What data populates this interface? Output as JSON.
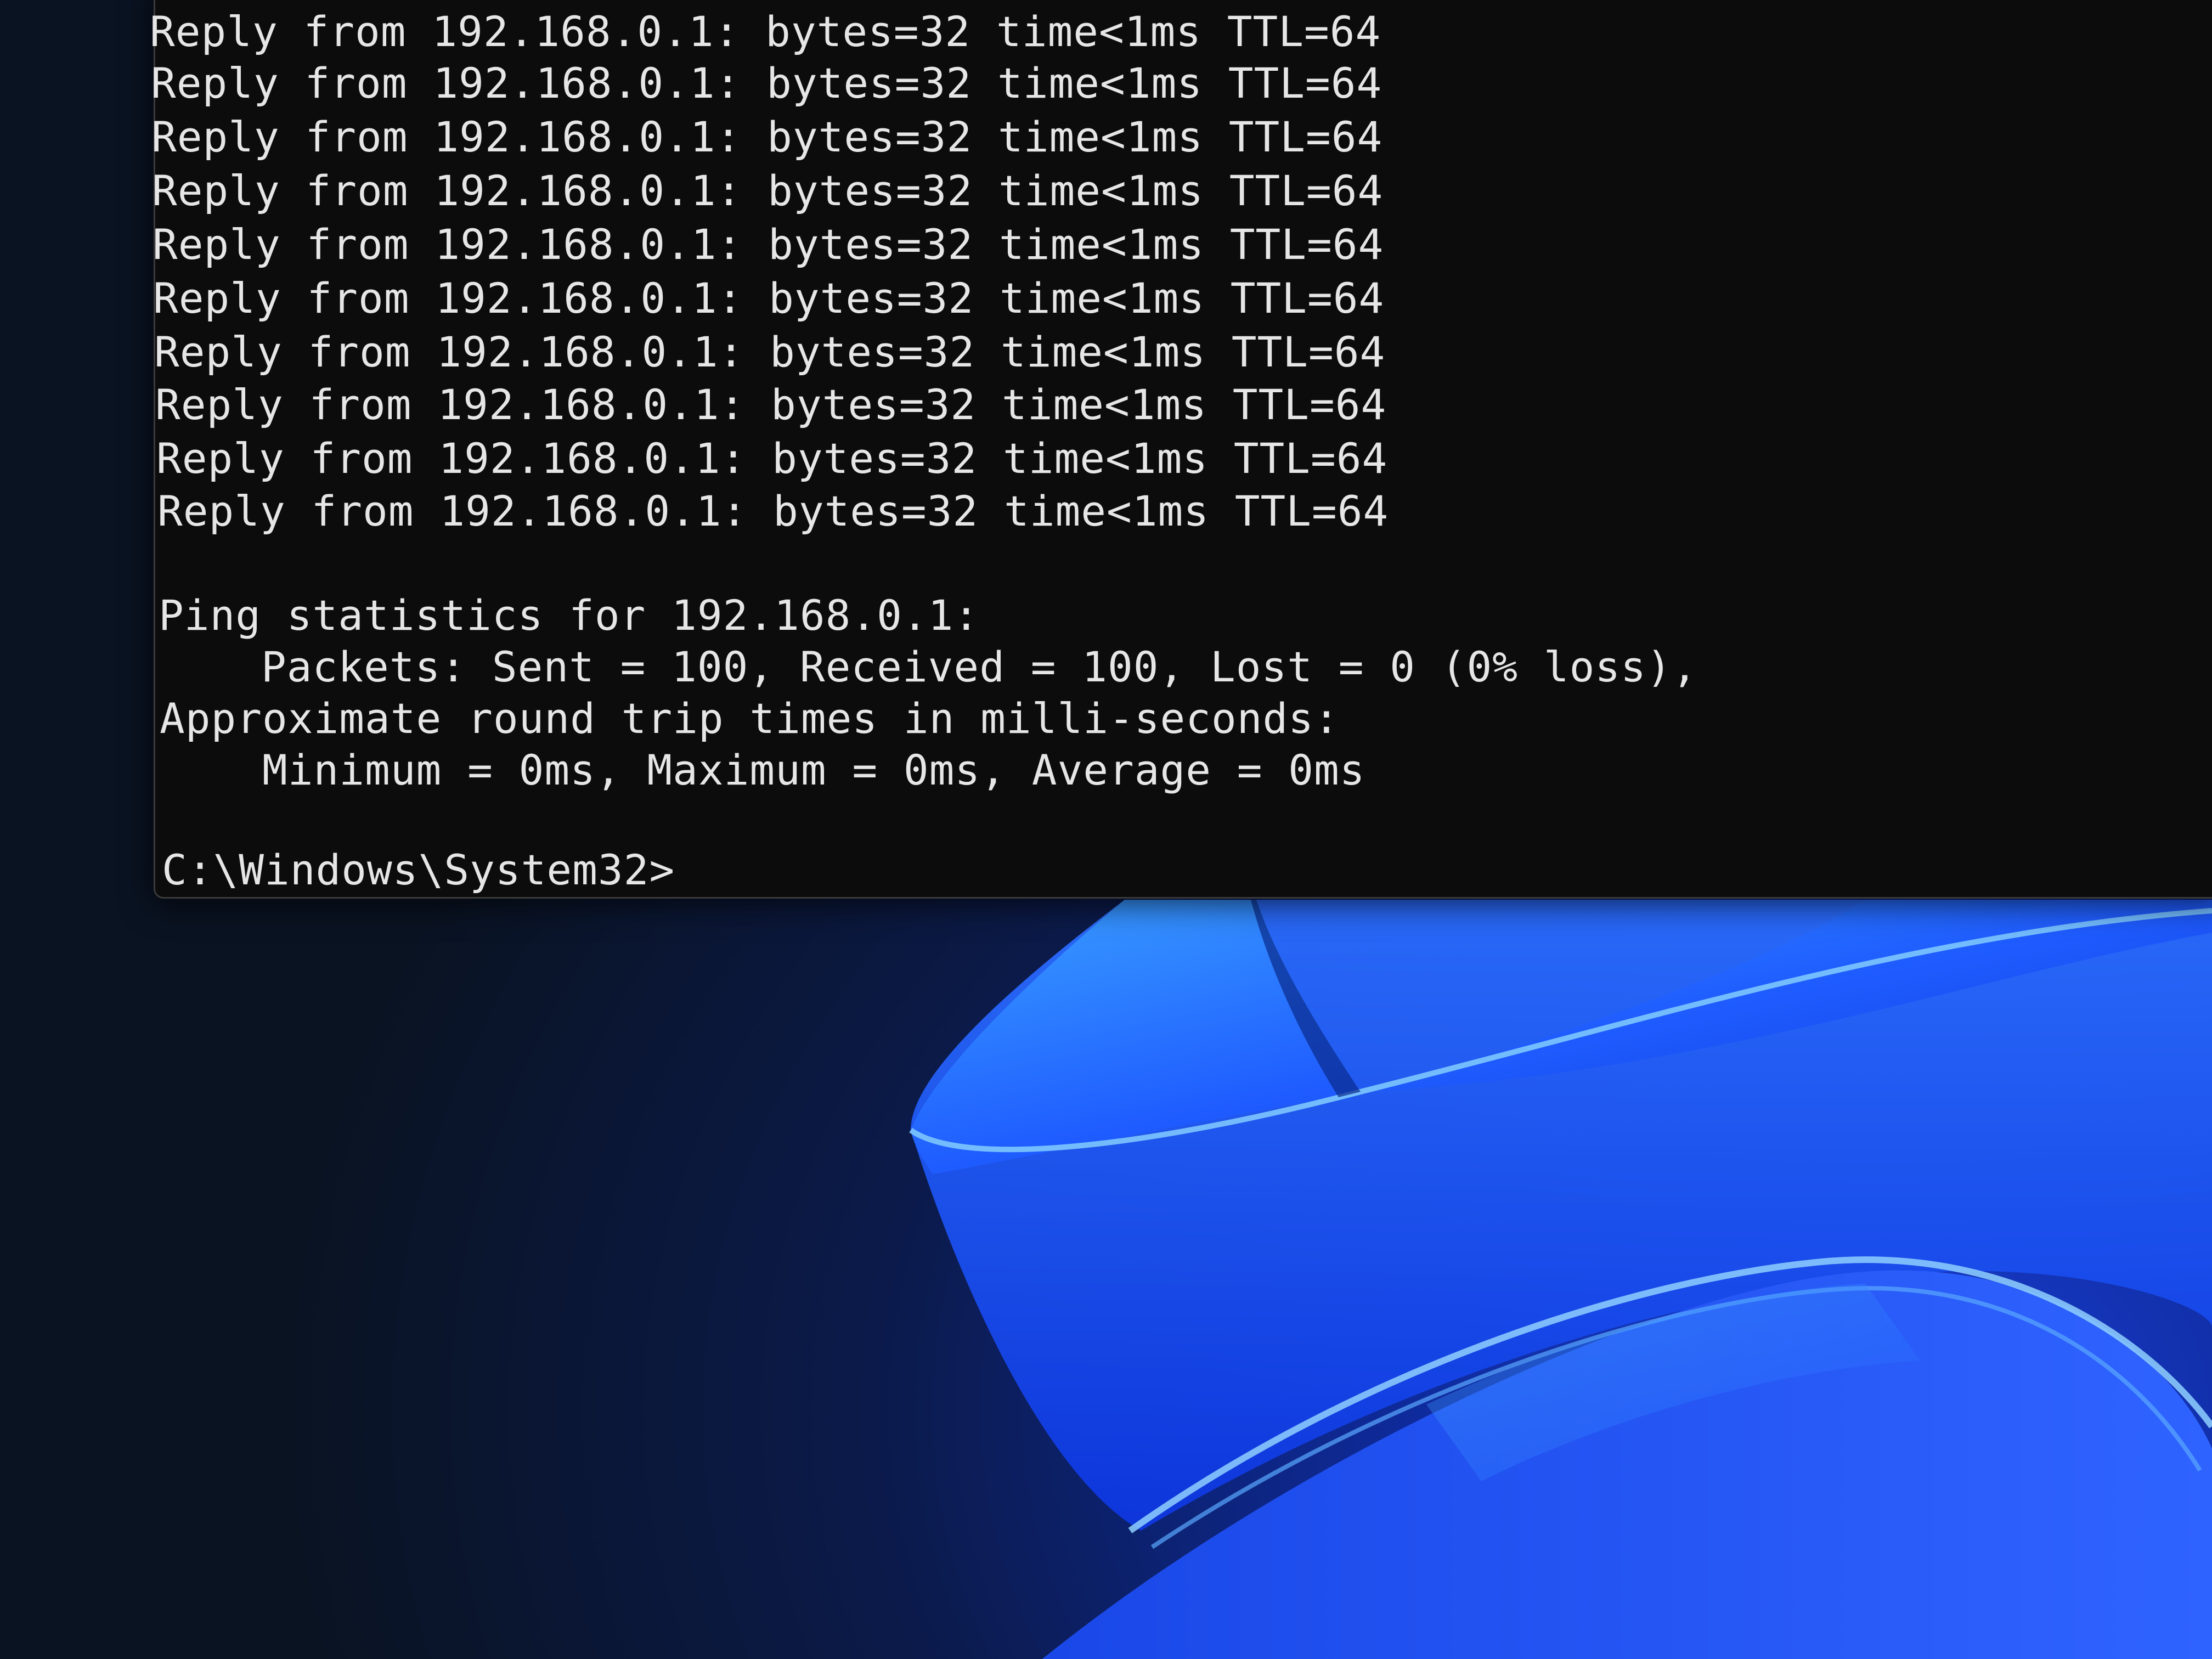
{
  "terminal": {
    "reply_lines": [
      "Reply from 192.168.0.1: bytes=32 time<1ms TTL=64",
      "Reply from 192.168.0.1: bytes=32 time<1ms TTL=64",
      "Reply from 192.168.0.1: bytes=32 time<1ms TTL=64",
      "Reply from 192.168.0.1: bytes=32 time<1ms TTL=64",
      "Reply from 192.168.0.1: bytes=32 time<1ms TTL=64",
      "Reply from 192.168.0.1: bytes=32 time<1ms TTL=64",
      "Reply from 192.168.0.1: bytes=32 time<1ms TTL=64",
      "Reply from 192.168.0.1: bytes=32 time<1ms TTL=64",
      "Reply from 192.168.0.1: bytes=32 time<1ms TTL=64",
      "Reply from 192.168.0.1: bytes=32 time<1ms TTL=64"
    ],
    "stats_header": "Ping statistics for 192.168.0.1:",
    "packets_line": "    Packets: Sent = 100, Received = 100, Lost = 0 (0% loss),",
    "rtt_header": "Approximate round trip times in milli-seconds:",
    "rtt_line": "    Minimum = 0ms, Maximum = 0ms, Average = 0ms",
    "prompt": "C:\\Windows\\System32>"
  },
  "colors": {
    "terminal_bg": "#0c0c0c",
    "terminal_text": "#e6e6e6",
    "wallpaper_accent": "#1f4fff"
  }
}
